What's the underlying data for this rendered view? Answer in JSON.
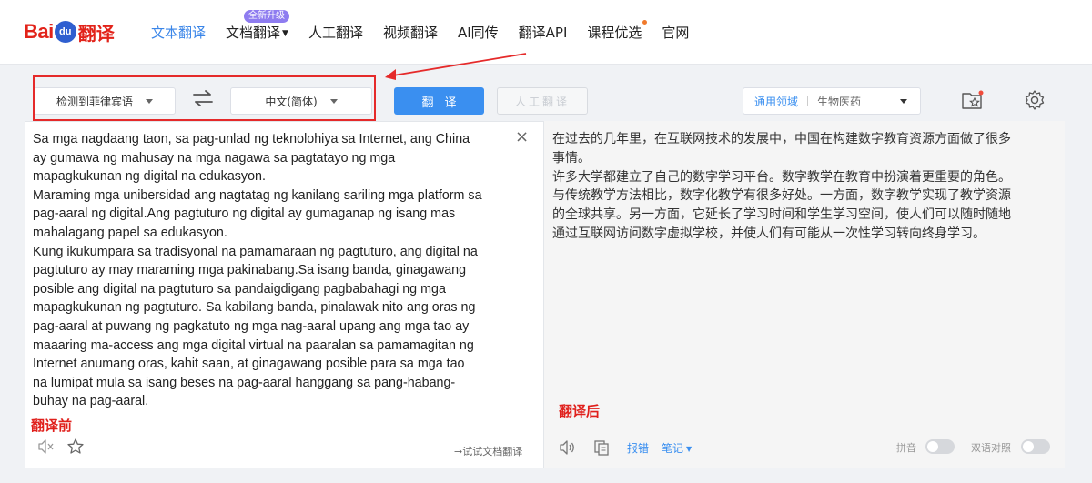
{
  "brand": {
    "logo_left": "Bai",
    "logo_paw": "du",
    "logo_right": "翻译"
  },
  "nav": {
    "items": [
      {
        "label": "文本翻译",
        "active": true
      },
      {
        "label": "文档翻译",
        "badge": "全新升级",
        "dropdown": true
      },
      {
        "label": "人工翻译"
      },
      {
        "label": "视频翻译"
      },
      {
        "label": "AI同传"
      },
      {
        "label": "翻译API"
      },
      {
        "label": "课程优选",
        "dot": true
      },
      {
        "label": "官网"
      }
    ]
  },
  "toolbar": {
    "source_lang": "检测到菲律宾语",
    "target_lang": "中文(简体)",
    "translate_label": "翻译",
    "human_translate_label": "人工翻译",
    "domain_general": "通用领域",
    "domain_specific": "生物医药"
  },
  "source": {
    "text": "Sa mga nagdaang taon, sa pag-unlad ng teknolohiya sa Internet, ang China\nay gumawa ng mahusay na mga nagawa sa pagtatayo ng mga\nmapagkukunan ng digital na edukasyon.\nMaraming mga unibersidad ang nagtatag ng kanilang sariling mga platform sa\npag-aaral ng digital.Ang pagtuturo ng digital ay gumaganap ng isang mas\nmahalagang papel sa edukasyon.\nKung ikukumpara sa tradisyonal na pamamaraan ng pagtuturo, ang digital na\npagtuturo ay may maraming mga pakinabang.Sa isang banda, ginagawang\nposible ang digital na pagtuturo sa pandaigdigang pagbabahagi ng mga\nmapagkukunan ng pagtuturo. Sa kabilang banda, pinalawak nito ang oras ng\npag-aaral at puwang ng pagkatuto ng mga nag-aaral upang ang mga tao ay\nmaaaring ma-access ang mga digital virtual na paaralan sa pamamagitan ng\nInternet anumang oras, kahit saan, at ginagawang posible para sa mga tao\nna lumipat mula sa isang beses na pag-aaral hanggang sa pang-habang-\nbuhay na pag-aaral.",
    "clear_symbol": "×",
    "annotation": "翻译前",
    "doc_link": "→试试文档翻译"
  },
  "target": {
    "text": "在过去的几年里，在互联网技术的发展中，中国在构建数字教育资源方面做了很多\n事情。\n许多大学都建立了自己的数字学习平台。数字教学在教育中扮演着更重要的角色。\n与传统教学方法相比，数字化教学有很多好处。一方面，数字教学实现了教学资源\n的全球共享。另一方面，它延长了学习时间和学生学习空间，使人们可以随时随地\n通过互联网访问数字虚拟学校，并使人们有可能从一次性学习转向终身学习。",
    "annotation": "翻译后",
    "report_label": "报错",
    "notes_label": "笔记",
    "pinyin_label": "拼音",
    "bilingual_label": "双语对照"
  },
  "colors": {
    "accent": "#3a8ff0",
    "annotation_red": "#e52a2a"
  }
}
